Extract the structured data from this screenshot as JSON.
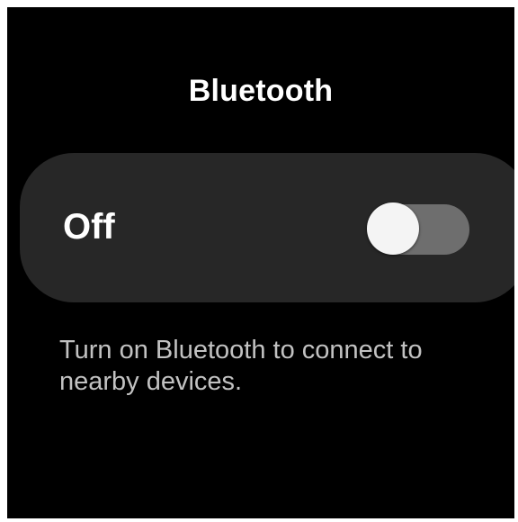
{
  "header": {
    "title": "Bluetooth"
  },
  "bluetooth_toggle": {
    "state_label": "Off",
    "enabled": false
  },
  "description": "Turn on Bluetooth to connect to nearby devices.",
  "colors": {
    "background": "#000000",
    "card": "#272727",
    "track_off": "#6e6e6e",
    "thumb": "#f4f4f4",
    "text_primary": "#ffffff",
    "text_secondary": "#c2c2c2"
  }
}
